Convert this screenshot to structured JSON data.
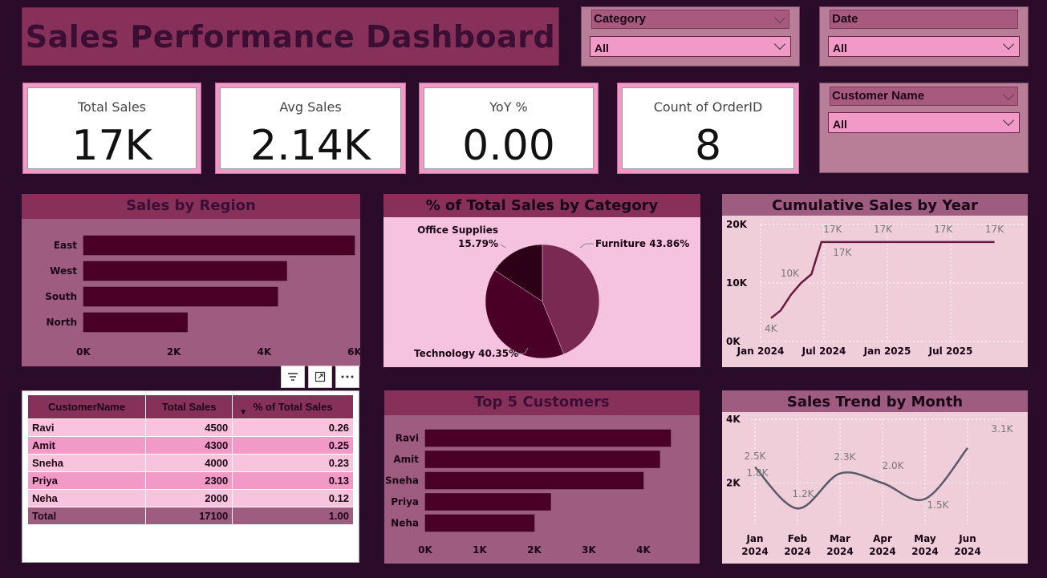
{
  "title": "Sales Performance Dashboard",
  "slicers": {
    "category": {
      "label": "Category",
      "value": "All"
    },
    "date": {
      "label": "Date",
      "value": "All"
    },
    "customer": {
      "label": "Customer Name",
      "value": "All"
    }
  },
  "kpis": [
    {
      "label": "Total Sales",
      "value": "17K"
    },
    {
      "label": "Avg Sales",
      "value": "2.14K"
    },
    {
      "label": "YoY %",
      "value": "0.00"
    },
    {
      "label": "Count of OrderID",
      "value": "8"
    }
  ],
  "region_chart": {
    "title": "Sales by Region"
  },
  "category_chart": {
    "title": "% of Total Sales by Category"
  },
  "cumulative_chart": {
    "title": "Cumulative Sales by Year"
  },
  "top5_chart": {
    "title": "Top 5 Customers"
  },
  "trend_chart": {
    "title": "Sales Trend by Month"
  },
  "table": {
    "headers": [
      "CustomerName",
      "Total Sales",
      "% of Total Sales"
    ],
    "rows": [
      [
        "Ravi",
        "4500",
        "0.26"
      ],
      [
        "Amit",
        "4300",
        "0.25"
      ],
      [
        "Sneha",
        "4000",
        "0.23"
      ],
      [
        "Priya",
        "2300",
        "0.13"
      ],
      [
        "Neha",
        "2000",
        "0.12"
      ]
    ],
    "total": [
      "Total",
      "17100",
      "1.00"
    ]
  },
  "colors": {
    "background": "#2a0b2a",
    "accent": "#87305a",
    "bar": "#4a0026",
    "slicer": "#f29ac7"
  },
  "chart_data": [
    {
      "type": "bar",
      "orientation": "horizontal",
      "title": "Sales by Region",
      "categories": [
        "East",
        "West",
        "South",
        "North"
      ],
      "values": [
        6000,
        4500,
        4300,
        2300
      ],
      "xlim": [
        0,
        6000
      ],
      "xticks": [
        "0K",
        "2K",
        "4K",
        "6K"
      ]
    },
    {
      "type": "pie",
      "title": "% of Total Sales by Category",
      "slices": [
        {
          "label": "Furniture",
          "pct_label": "43.86%",
          "value": 43.86,
          "color": "#7a2a52"
        },
        {
          "label": "Technology",
          "pct_label": "40.35%",
          "value": 40.35,
          "color": "#4a0026"
        },
        {
          "label": "Office Supplies",
          "pct_label": "15.79%",
          "value": 15.79,
          "color": "#2e0018"
        }
      ]
    },
    {
      "type": "line",
      "title": "Cumulative Sales by Year",
      "x": [
        "2024-02",
        "2024-03",
        "2024-04",
        "2024-05",
        "2024-06",
        "2024-07",
        "2024-08",
        "2025-01",
        "2025-07",
        "2025-12"
      ],
      "y": [
        4000,
        5300,
        8000,
        10000,
        11500,
        17000,
        17000,
        17000,
        17000,
        17000
      ],
      "data_labels": [
        {
          "x": "2024-02",
          "y": 4000,
          "text": "4K"
        },
        {
          "x": "2024-05",
          "y": 10000,
          "text": "10K"
        },
        {
          "x": "2024-07",
          "y": 17000,
          "text": "17K"
        },
        {
          "x": "2024-07",
          "y": 17000,
          "text": "17K"
        },
        {
          "x": "2025-01",
          "y": 17000,
          "text": "17K"
        },
        {
          "x": "2025-07",
          "y": 17000,
          "text": "17K"
        },
        {
          "x": "2025-12",
          "y": 17000,
          "text": "17K"
        }
      ],
      "ylim": [
        0,
        20000
      ],
      "yticks": [
        "0K",
        "10K",
        "20K"
      ],
      "xticks": [
        "Jan 2024",
        "Jul 2024",
        "Jan 2025",
        "Jul 2025"
      ]
    },
    {
      "type": "bar",
      "orientation": "horizontal",
      "title": "Top 5 Customers",
      "categories": [
        "Ravi",
        "Amit",
        "Sneha",
        "Priya",
        "Neha"
      ],
      "values": [
        4500,
        4300,
        4000,
        2300,
        2000
      ],
      "xlim": [
        0,
        4500
      ],
      "xticks": [
        "0K",
        "1K",
        "2K",
        "3K",
        "4K"
      ]
    },
    {
      "type": "line",
      "title": "Sales Trend by Month",
      "x": [
        "Jan 2024",
        "Feb 2024",
        "Mar 2024",
        "Apr 2024",
        "May 2024",
        "Jun 2024"
      ],
      "y": [
        2500,
        1200,
        2300,
        2000,
        1500,
        3100
      ],
      "data_labels": [
        "2.5K",
        "1.8K",
        "1.2K",
        "2.3K",
        "2.0K",
        "1.5K",
        "3.1K"
      ],
      "ylim": [
        0,
        4000
      ],
      "yticks": [
        "2K",
        "4K"
      ],
      "xtick_months": [
        "Jan",
        "Feb",
        "Mar",
        "Apr",
        "May",
        "Jun"
      ],
      "xtick_year": "2024"
    }
  ]
}
